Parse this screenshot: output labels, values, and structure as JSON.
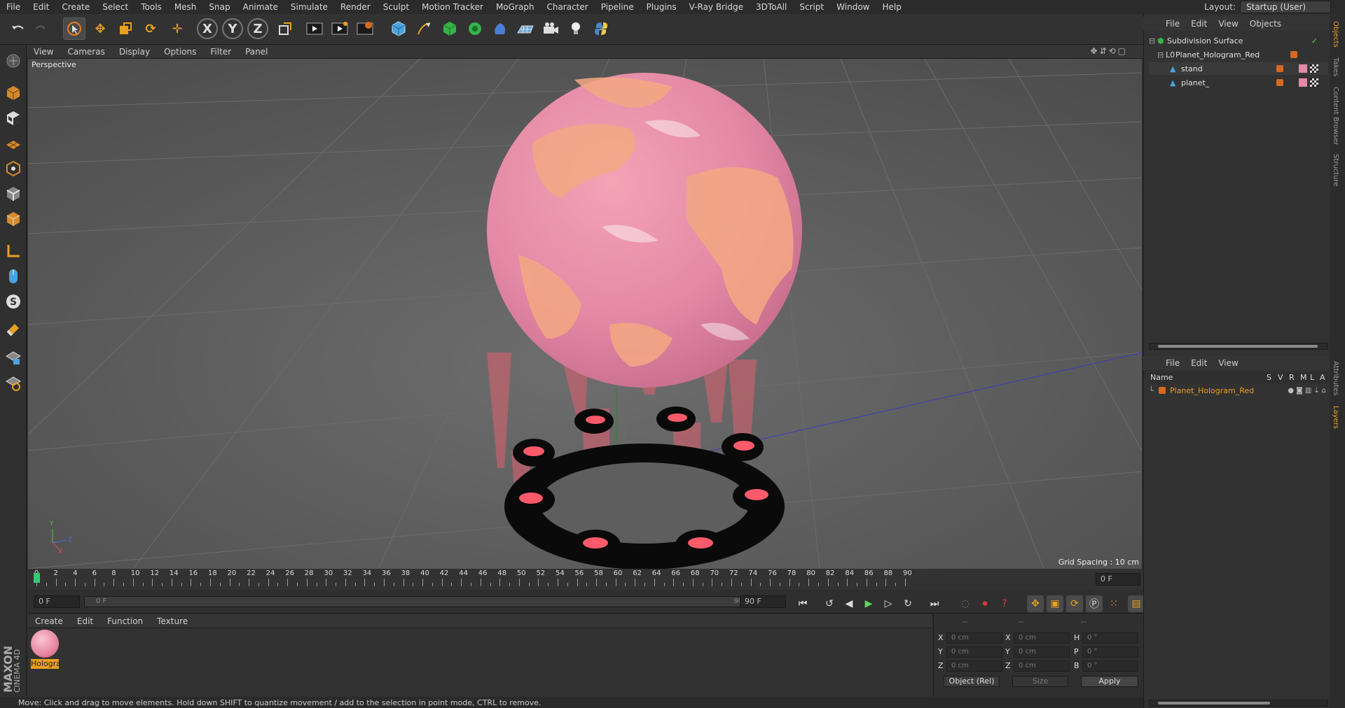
{
  "menubar": {
    "items": [
      "File",
      "Edit",
      "Create",
      "Select",
      "Tools",
      "Mesh",
      "Snap",
      "Animate",
      "Simulate",
      "Render",
      "Sculpt",
      "Motion Tracker",
      "MoGraph",
      "Character",
      "Pipeline",
      "Plugins",
      "V-Ray Bridge",
      "3DToAll",
      "Script",
      "Window",
      "Help"
    ],
    "layout_label": "Layout:",
    "layout_value": "Startup (User)"
  },
  "toolbar": {
    "axis_x": "X",
    "axis_y": "Y",
    "axis_z": "Z"
  },
  "viewport": {
    "menu": [
      "View",
      "Cameras",
      "Display",
      "Options",
      "Filter",
      "Panel"
    ],
    "camera_label": "Perspective",
    "grid_spacing": "Grid Spacing : 10 cm",
    "axis_labels": {
      "y": "Y",
      "z": "Z",
      "x": "X"
    }
  },
  "timeline": {
    "ticks": [
      "0",
      "2",
      "4",
      "6",
      "8",
      "10",
      "12",
      "14",
      "16",
      "18",
      "20",
      "22",
      "24",
      "26",
      "28",
      "30",
      "32",
      "34",
      "36",
      "38",
      "40",
      "42",
      "44",
      "46",
      "48",
      "50",
      "52",
      "54",
      "56",
      "58",
      "60",
      "62",
      "64",
      "66",
      "68",
      "70",
      "72",
      "74",
      "76",
      "78",
      "80",
      "82",
      "84",
      "86",
      "88",
      "90"
    ],
    "current_frame": "0 F",
    "start_field": "0 F",
    "range_start": "0 F",
    "range_end": "90 F",
    "end_field": "90 F",
    "current_progress": 0
  },
  "material_manager": {
    "menu": [
      "Create",
      "Edit",
      "Function",
      "Texture"
    ],
    "materials": [
      {
        "name": "Hologra"
      }
    ]
  },
  "coordinates": {
    "header": [
      "--",
      "--",
      "--"
    ],
    "rows": [
      {
        "a_label": "X",
        "a": "0 cm",
        "b_label": "X",
        "b": "0 cm",
        "c_label": "H",
        "c": "0 °"
      },
      {
        "a_label": "Y",
        "a": "0 cm",
        "b_label": "Y",
        "b": "0 cm",
        "c_label": "P",
        "c": "0 °"
      },
      {
        "a_label": "Z",
        "a": "0 cm",
        "b_label": "Z",
        "b": "0 cm",
        "c_label": "B",
        "c": "0 °"
      }
    ],
    "mode": "Object (Rel)",
    "size_mode": "Size",
    "apply": "Apply"
  },
  "status": "Move: Click and drag to move elements. Hold down SHIFT to quantize movement / add to the selection in point mode, CTRL to remove.",
  "object_manager": {
    "menu": [
      "File",
      "Edit",
      "View",
      "Objects"
    ],
    "items": [
      {
        "name": "Subdivision Surface",
        "level": 0
      },
      {
        "name": "Planet_Hologram_Red",
        "level": 1
      },
      {
        "name": "stand",
        "level": 2
      },
      {
        "name": "planet_",
        "level": 2
      }
    ]
  },
  "layer_manager": {
    "menu": [
      "File",
      "Edit",
      "View"
    ],
    "columns": {
      "name": "Name",
      "s": "S",
      "v": "V",
      "r": "R",
      "m": "M",
      "l": "L",
      "a": "A"
    },
    "items": [
      {
        "name": "Planet_Hologram_Red"
      }
    ]
  },
  "side_tabs": [
    "Objects",
    "Takes",
    "Content Browser",
    "Structure",
    "Attributes",
    "Layers"
  ],
  "brand": {
    "maxon": "MAXON",
    "product": "CINEMA 4D"
  },
  "colors": {
    "accent_orange": "#d9681e",
    "selection": "#4a4a4a",
    "play_green": "#5fd35f",
    "record_red": "#d63c3c"
  }
}
